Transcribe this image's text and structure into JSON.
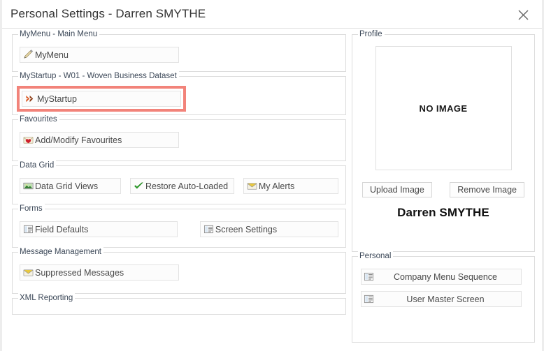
{
  "window": {
    "title": "Personal Settings - Darren SMYTHE",
    "close_label": "close-icon"
  },
  "left_column": {
    "sections": [
      {
        "legend": "MyMenu - Main Menu",
        "buttons": [
          {
            "label": "MyMenu",
            "icon": "pencil-arrow-icon"
          }
        ]
      },
      {
        "legend": "MyStartup - W01 - Woven Business Dataset",
        "highlighted": true,
        "buttons": [
          {
            "label": "MyStartup",
            "icon": "double-chevron-right-icon"
          }
        ]
      },
      {
        "legend": "Favourites",
        "buttons": [
          {
            "label": "Add/Modify Favourites",
            "icon": "envelope-heart-icon"
          }
        ]
      },
      {
        "legend": "Data Grid",
        "buttons": [
          {
            "label": "Data Grid Views",
            "icon": "picture-icon"
          },
          {
            "label": "Restore Auto-Loaded",
            "icon": "green-check-icon"
          },
          {
            "label": "My Alerts",
            "icon": "envelope-icon"
          }
        ]
      },
      {
        "legend": "Forms",
        "buttons": [
          {
            "label": "Field Defaults",
            "icon": "form-list-icon"
          },
          {
            "label": "Screen Settings",
            "icon": "form-list-icon"
          }
        ]
      },
      {
        "legend": "Message Management",
        "buttons": [
          {
            "label": "Suppressed Messages",
            "icon": "envelope-icon"
          }
        ]
      },
      {
        "legend": "XML Reporting",
        "buttons": []
      }
    ]
  },
  "right_column": {
    "profile": {
      "legend": "Profile",
      "no_image_text": "NO IMAGE",
      "upload_label": "Upload Image",
      "remove_label": "Remove Image",
      "user_name": "Darren SMYTHE"
    },
    "personal": {
      "legend": "Personal",
      "buttons": [
        {
          "label": "Company Menu Sequence",
          "icon": "form-list-icon"
        },
        {
          "label": "User Master Screen",
          "icon": "form-list-icon"
        }
      ]
    }
  },
  "colors": {
    "highlight_border": "#f2837a",
    "legend_text": "#3c4858",
    "button_text": "#4a4a4a",
    "panel_border": "#dcdcdc",
    "title_text": "#333333"
  }
}
